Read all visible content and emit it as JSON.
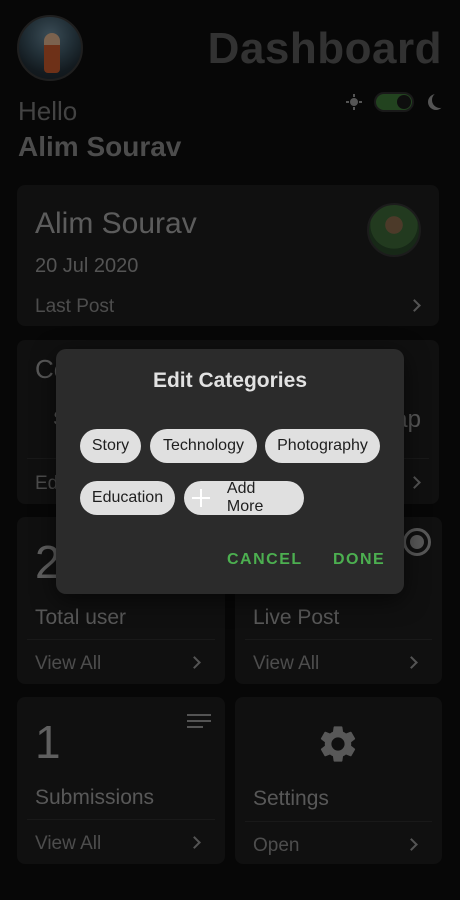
{
  "header": {
    "title": "Dashboard",
    "greeting": "Hello",
    "user_name": "Alim Sourav"
  },
  "theme_toggle": {
    "dark_mode_on": true
  },
  "profile_card": {
    "name": "Alim Sourav",
    "date": "20 Jul 2020",
    "link_label": "Last Post"
  },
  "categories_card": {
    "title_partial": "Co",
    "chip_partial_left": "S",
    "chip_partial_right": "ap",
    "link_partial": "Ed"
  },
  "total_user_card": {
    "number_partial": "2",
    "label": "Total user",
    "link_label": "View All"
  },
  "live_post_card": {
    "label": "Live Post",
    "link_label": "View All"
  },
  "submissions_card": {
    "number": "1",
    "label": "Submissions",
    "link_label": "View All"
  },
  "settings_card": {
    "label": "Settings",
    "link_label": "Open"
  },
  "dialog": {
    "title": "Edit Categories",
    "chips": [
      "Story",
      "Technology",
      "Photography",
      "Education"
    ],
    "add_more_label": "Add More",
    "cancel_label": "CANCEL",
    "done_label": "DONE"
  },
  "colors": {
    "accent": "#4caf50",
    "background": "#0d0d0d",
    "card": "#1e1e1e",
    "dialog": "#2b2b2b"
  }
}
